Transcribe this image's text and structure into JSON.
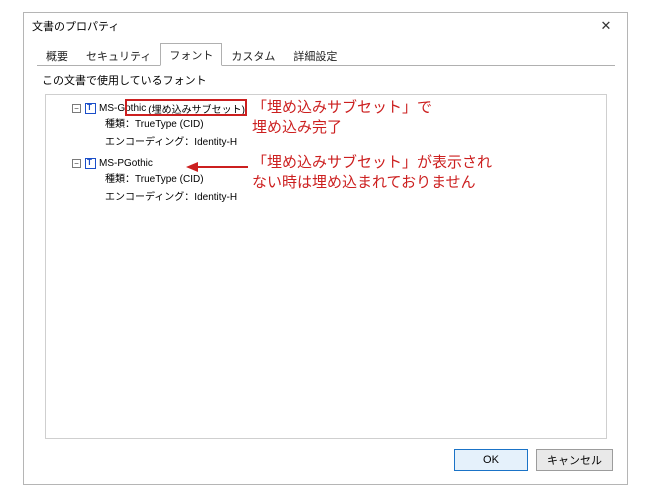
{
  "dialog": {
    "title": "文書のプロパティ",
    "close_glyph": "✕"
  },
  "tabs": {
    "overview": "概要",
    "security": "セキュリティ",
    "fonts": "フォント",
    "custom": "カスタム",
    "advanced": "詳細設定"
  },
  "fonts_tab": {
    "group_label": "この文書で使用しているフォント",
    "items": [
      {
        "toggle": "−",
        "name": "MS-Gothic",
        "embed_label": "(埋め込みサブセット)",
        "type_line": "種類：TrueType (CID)",
        "encoding_line": "エンコーディング：Identity-H"
      },
      {
        "toggle": "−",
        "name": "MS-PGothic",
        "embed_label": "",
        "type_line": "種類：TrueType (CID)",
        "encoding_line": "エンコーディング：Identity-H"
      }
    ]
  },
  "annotations": {
    "a1_line1": "「埋め込みサブセット」で",
    "a1_line2": "埋め込み完了",
    "a2_line1": "「埋め込みサブセット」が表示され",
    "a2_line2": "ない時は埋め込まれておりません"
  },
  "buttons": {
    "ok": "OK",
    "cancel": "キャンセル"
  },
  "colors": {
    "annotation_red": "#cc1f1f"
  }
}
